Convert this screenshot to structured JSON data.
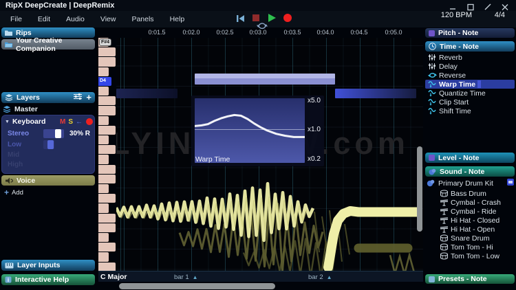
{
  "app": {
    "title": "RipX DeepCreate | DeepRemix",
    "bpm": "120 BPM",
    "time_signature": "4/4"
  },
  "menu": {
    "items": [
      "File",
      "Edit",
      "Audio",
      "View",
      "Panels",
      "Help"
    ]
  },
  "timeline": {
    "labels": [
      "0:01.5",
      "0:02.0",
      "0:02.5",
      "0:03.0",
      "0:03.5",
      "0:04.0",
      "0:04.5",
      "0:05.0"
    ]
  },
  "piano": {
    "key_signature": "C Major",
    "keys": [
      {
        "n": "F#4",
        "t": "b",
        "badge": true
      },
      {
        "n": "F4",
        "t": "w"
      },
      {
        "n": "E4",
        "t": "w"
      },
      {
        "n": "D#4",
        "t": "b"
      },
      {
        "n": "D4",
        "t": "w",
        "highlight": true
      },
      {
        "n": "C#4",
        "t": "b"
      },
      {
        "n": "C4",
        "t": "w"
      },
      {
        "n": "B3",
        "t": "w"
      },
      {
        "n": "A#3",
        "t": "b"
      },
      {
        "n": "A3",
        "t": "w"
      },
      {
        "n": "G#3",
        "t": "b"
      },
      {
        "n": "G3",
        "t": "w"
      },
      {
        "n": "F#3",
        "t": "b"
      },
      {
        "n": "F3",
        "t": "w"
      },
      {
        "n": "E3",
        "t": "w"
      },
      {
        "n": "D#3",
        "t": "b"
      },
      {
        "n": "D3",
        "t": "w"
      },
      {
        "n": "C#3",
        "t": "b"
      },
      {
        "n": "C3",
        "t": "w"
      },
      {
        "n": "B2",
        "t": "w"
      },
      {
        "n": "A#2",
        "t": "b"
      },
      {
        "n": "A2",
        "t": "w"
      },
      {
        "n": "G#2",
        "t": "b"
      },
      {
        "n": "G2",
        "t": "w"
      }
    ]
  },
  "ruler": {
    "bar1": "bar 1",
    "bar2": "bar 2"
  },
  "watermark": {
    "text": "LYING-DAW.com"
  },
  "warp": {
    "title": "Warp Time",
    "labels": {
      "top": "x5.0",
      "mid": "x1.0",
      "bottom": "x0.2"
    },
    "curve": [
      [
        0,
        0.43
      ],
      [
        0.06,
        0.42
      ],
      [
        0.12,
        0.4
      ],
      [
        0.18,
        0.35
      ],
      [
        0.24,
        0.31
      ],
      [
        0.3,
        0.28
      ],
      [
        0.36,
        0.26
      ],
      [
        0.42,
        0.27
      ],
      [
        0.48,
        0.32
      ],
      [
        0.54,
        0.39
      ],
      [
        0.6,
        0.45
      ],
      [
        0.66,
        0.5
      ],
      [
        0.74,
        0.55
      ],
      [
        0.82,
        0.58
      ],
      [
        0.9,
        0.6
      ],
      [
        1,
        0.6
      ]
    ]
  },
  "left": {
    "rips": "Rips",
    "companion": "Your Creative Companion",
    "layers_header": "Layers",
    "master": "Master",
    "keyboard": {
      "name": "Keyboard",
      "mute": "M",
      "solo": "S",
      "stereo_label": "Stereo",
      "stereo_value": "30% R",
      "bands": [
        "Low",
        "Mid",
        "High"
      ]
    },
    "voice": "Voice",
    "add": "Add",
    "layer_inputs": "Layer Inputs",
    "interactive_help": "Interactive Help"
  },
  "right": {
    "pitch": "Pitch - Note",
    "time": "Time - Note",
    "time_items": [
      {
        "label": "Reverb",
        "icon": "fader"
      },
      {
        "label": "Delay",
        "icon": "fader"
      },
      {
        "label": "Reverse",
        "icon": "reverse"
      },
      {
        "label": "Warp Time",
        "icon": "wave",
        "selected": true
      },
      {
        "label": "Quantize Time",
        "icon": "wave"
      },
      {
        "label": "Clip Start",
        "icon": "wave"
      },
      {
        "label": "Shift Time",
        "icon": "wave"
      }
    ],
    "level": "Level - Note",
    "sound": "Sound - Note",
    "kit": "Primary Drum Kit",
    "drums": [
      {
        "label": "Bass Drum",
        "icon": "drum"
      },
      {
        "label": "Cymbal - Crash",
        "icon": "cymbal"
      },
      {
        "label": "Cymbal - Ride",
        "icon": "cymbal"
      },
      {
        "label": "Hi Hat - Closed",
        "icon": "cymbal"
      },
      {
        "label": "Hi Hat - Open",
        "icon": "cymbal"
      },
      {
        "label": "Snare Drum",
        "icon": "drum"
      },
      {
        "label": "Tom Tom - Hi",
        "icon": "drum"
      },
      {
        "label": "Tom Tom - Low",
        "icon": "drum"
      }
    ],
    "presets": "Presets - Note"
  },
  "colors": {
    "accent_blue": "#2f8fc4",
    "selection_blue": "#2b3da0",
    "play_green": "#2ebf4e",
    "record_red": "#ee1f1f",
    "stop_red": "#8f2b2b",
    "key_pink": "#e4c6ba",
    "note_purple": "#8b90d2",
    "note_blue": "#4050d8",
    "wave_yellow": "#efefa8",
    "wave_olive": "#6e6e38"
  }
}
